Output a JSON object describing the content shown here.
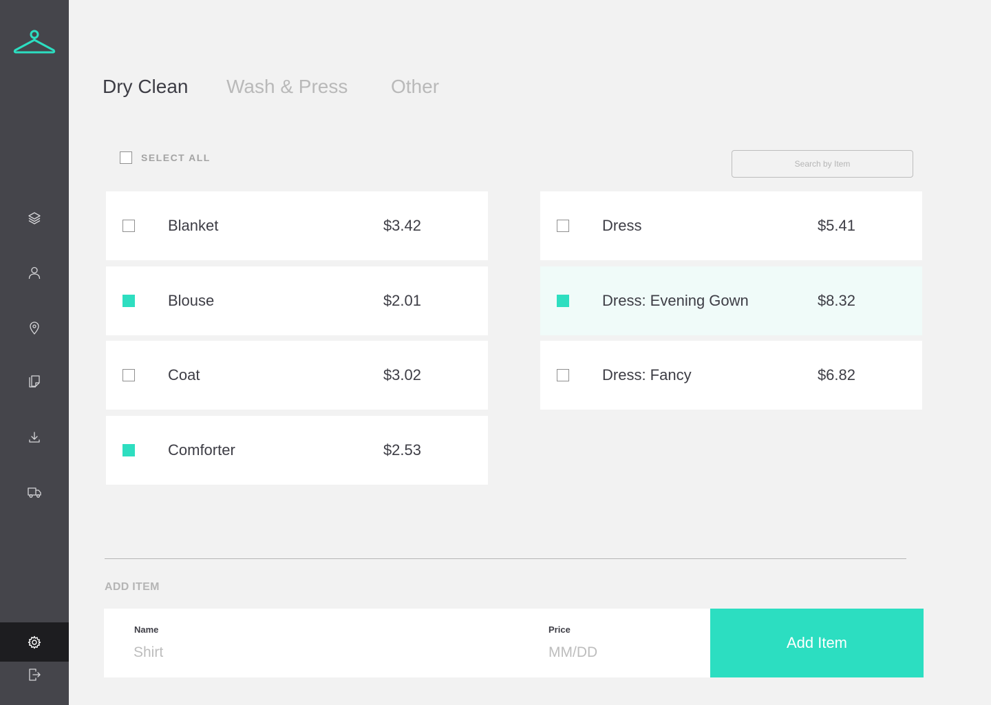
{
  "brand": {
    "accent": "#2cdec1",
    "sidebar_bg": "#45454b",
    "logo_icon": "hanger-icon"
  },
  "sidebar": {
    "items": [
      {
        "icon": "layers-icon"
      },
      {
        "icon": "user-icon"
      },
      {
        "icon": "location-pin-icon"
      },
      {
        "icon": "documents-icon"
      },
      {
        "icon": "download-icon"
      },
      {
        "icon": "truck-icon"
      }
    ],
    "settings_icon": "gear-icon",
    "logout_icon": "logout-icon"
  },
  "tabs": [
    {
      "label": "Dry Clean",
      "active": true
    },
    {
      "label": "Wash & Press",
      "active": false
    },
    {
      "label": "Other",
      "active": false
    }
  ],
  "select_all": {
    "label": "SELECT ALL",
    "checked": false
  },
  "search": {
    "placeholder": "Search by Item",
    "value": ""
  },
  "items_left": [
    {
      "name": "Blanket",
      "price": "$3.42",
      "checked": false
    },
    {
      "name": "Blouse",
      "price": "$2.01",
      "checked": true
    },
    {
      "name": "Coat",
      "price": "$3.02",
      "checked": false
    },
    {
      "name": "Comforter",
      "price": "$2.53",
      "checked": true
    }
  ],
  "items_right": [
    {
      "name": "Dress",
      "price": "$5.41",
      "checked": false
    },
    {
      "name": "Dress: Evening Gown",
      "price": "$8.32",
      "checked": true
    },
    {
      "name": "Dress: Fancy",
      "price": "$6.82",
      "checked": false
    }
  ],
  "add_item": {
    "heading": "ADD ITEM",
    "name_label": "Name",
    "name_placeholder": "Shirt",
    "name_value": "",
    "price_label": "Price",
    "price_placeholder": "MM/DD",
    "price_value": "",
    "button_label": "Add Item"
  }
}
